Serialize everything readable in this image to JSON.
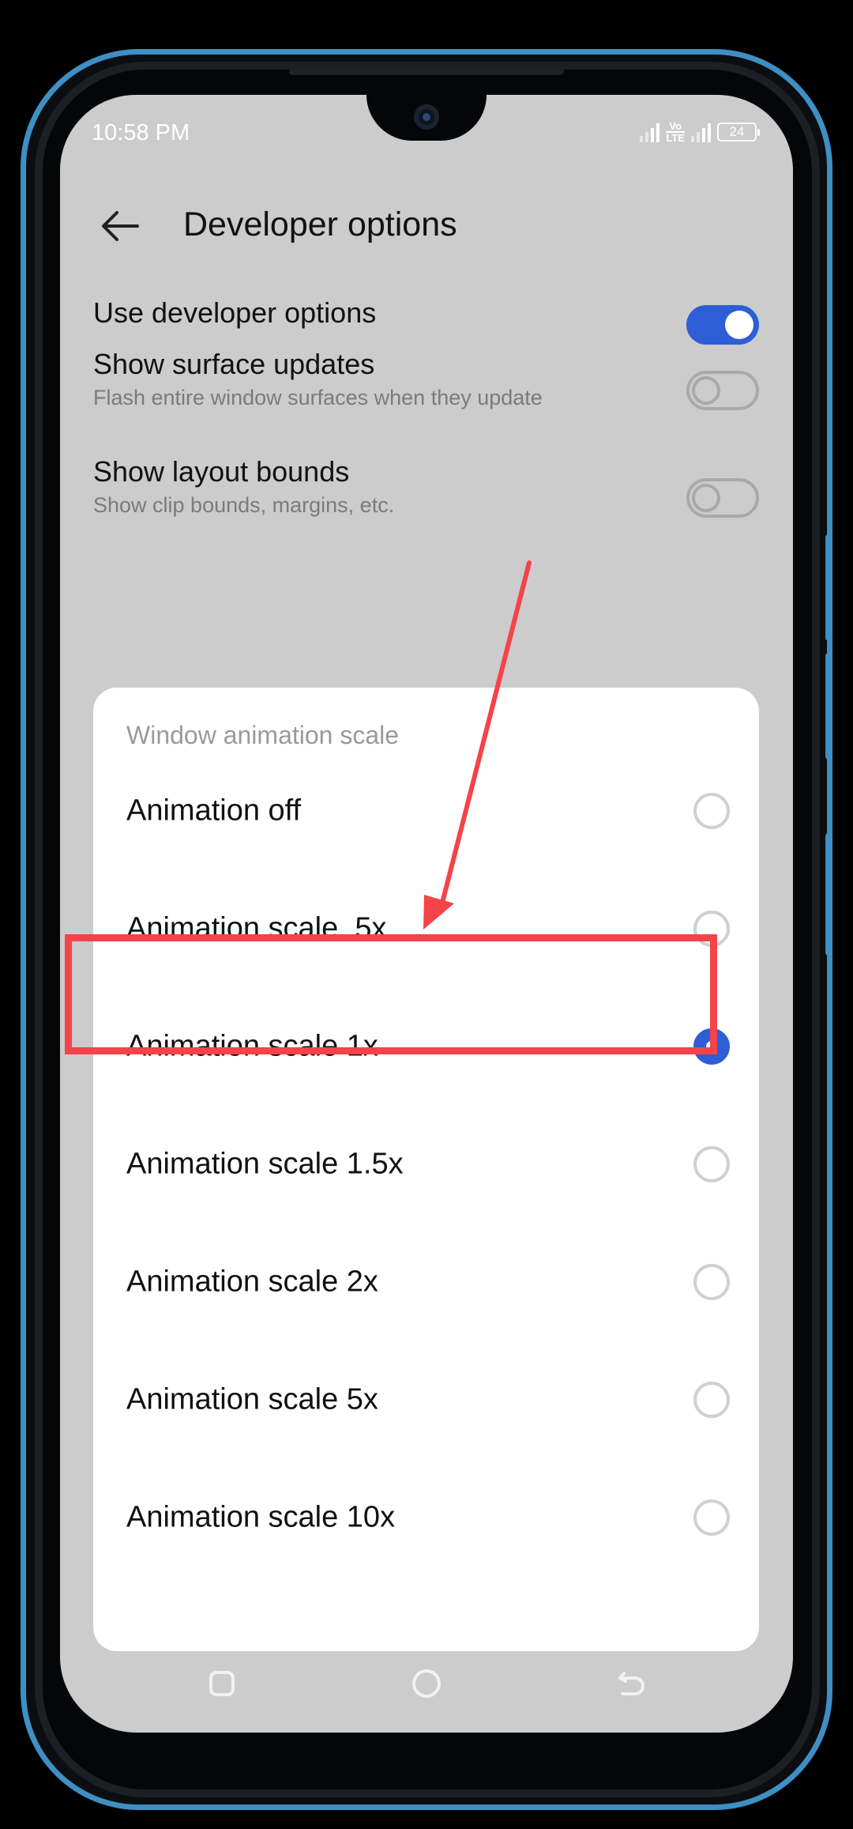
{
  "status_bar": {
    "time": "10:58 PM",
    "network_label_top": "Vo",
    "network_label_bottom": "LTE",
    "battery": "24"
  },
  "header": {
    "title": "Developer options",
    "back_icon": "arrow-left-icon"
  },
  "settings": [
    {
      "title": "Use developer options",
      "subtitle": "",
      "enabled": true
    },
    {
      "title": "Show surface updates",
      "subtitle": "Flash entire window surfaces when they update",
      "enabled": false
    },
    {
      "title": "Show layout bounds",
      "subtitle": "Show clip bounds, margins, etc.",
      "enabled": false
    }
  ],
  "dialog": {
    "title": "Window animation scale",
    "options": [
      {
        "label": "Animation off",
        "selected": false
      },
      {
        "label": "Animation scale .5x",
        "selected": false
      },
      {
        "label": "Animation scale 1x",
        "selected": true
      },
      {
        "label": "Animation scale 1.5x",
        "selected": false
      },
      {
        "label": "Animation scale 2x",
        "selected": false
      },
      {
        "label": "Animation scale 5x",
        "selected": false
      },
      {
        "label": "Animation scale 10x",
        "selected": false
      }
    ]
  },
  "annotation": {
    "highlighted_option": "Animation scale .5x",
    "color": "#f44349"
  },
  "colors": {
    "accent": "#2e5ed6",
    "screen_bg": "#cccccc",
    "frame_accent": "#3e8fc4"
  },
  "navigation": {
    "recent_icon": "square-icon",
    "home_icon": "circle-icon",
    "back_icon": "back-arrow-icon"
  }
}
